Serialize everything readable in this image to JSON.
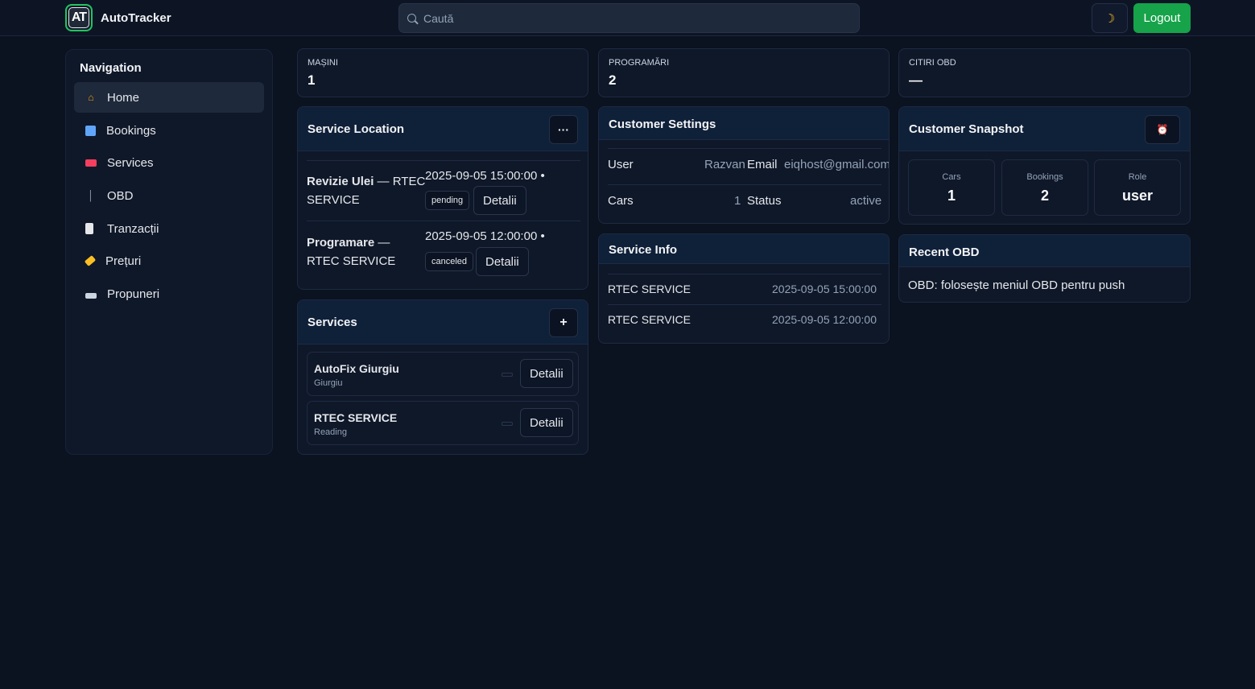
{
  "header": {
    "logo_text": "AT",
    "app_name": "AutoTracker",
    "search_placeholder": "Caută",
    "theme_icon": "moon-icon",
    "logout_label": "Logout",
    "accent_color": "#16a34a"
  },
  "sidebar": {
    "title": "Navigation",
    "items": [
      {
        "label": "Home",
        "icon": "home-icon",
        "active": true
      },
      {
        "label": "Bookings",
        "icon": "calendar-icon"
      },
      {
        "label": "Services",
        "icon": "toolbox-icon"
      },
      {
        "label": "OBD",
        "icon": "plug-icon"
      },
      {
        "label": "Tranzacții",
        "icon": "receipt-icon"
      },
      {
        "label": "Prețuri",
        "icon": "tag-icon"
      },
      {
        "label": "Propuneri",
        "icon": "inbox-icon"
      }
    ]
  },
  "stats": [
    {
      "label": "MAȘINI",
      "value": "1"
    },
    {
      "label": "PROGRAMĂRI",
      "value": "2"
    },
    {
      "label": "CITIRI OBD",
      "value": "—"
    }
  ],
  "service_location": {
    "title": "Service Location",
    "menu_label": "···",
    "appointments": [
      {
        "name": "Revizie Ulei",
        "location_line1": "— RTEC",
        "location_line2": "SERVICE",
        "datetime": "2025-09-05 15:00:00 •",
        "status": "pending",
        "details_label": "Detalii"
      },
      {
        "name": "Programare",
        "location_line1": "—",
        "location_line2": "RTEC SERVICE",
        "datetime": "2025-09-05 12:00:00 •",
        "status": "canceled",
        "details_label": "Detalii"
      }
    ]
  },
  "services": {
    "title": "Services",
    "add_label": "+",
    "items": [
      {
        "name": "AutoFix Giurgiu",
        "city": "Giurgiu",
        "details_label": "Detalii"
      },
      {
        "name": "RTEC SERVICE",
        "city": "Reading",
        "details_label": "Detalii"
      }
    ]
  },
  "customer_settings": {
    "title": "Customer Settings",
    "rows": [
      {
        "k1": "User",
        "v1": "Razvan",
        "k2": "Email",
        "v2": "eiqhost@gmail.com"
      },
      {
        "k1": "Cars",
        "v1": "1",
        "k2": "Status",
        "v2": "active"
      }
    ]
  },
  "service_info": {
    "title": "Service Info",
    "rows": [
      {
        "name": "RTEC SERVICE",
        "datetime": "2025-09-05 15:00:00"
      },
      {
        "name": "RTEC SERVICE",
        "datetime": "2025-09-05 12:00:00"
      }
    ]
  },
  "snapshot": {
    "title": "Customer Snapshot",
    "icon": "alarm-clock-icon",
    "boxes": [
      {
        "label": "Cars",
        "value": "1"
      },
      {
        "label": "Bookings",
        "value": "2"
      },
      {
        "label": "Role",
        "value": "user"
      }
    ]
  },
  "recent_obd": {
    "title": "Recent OBD",
    "text": "OBD: folosește meniul OBD pentru push"
  }
}
